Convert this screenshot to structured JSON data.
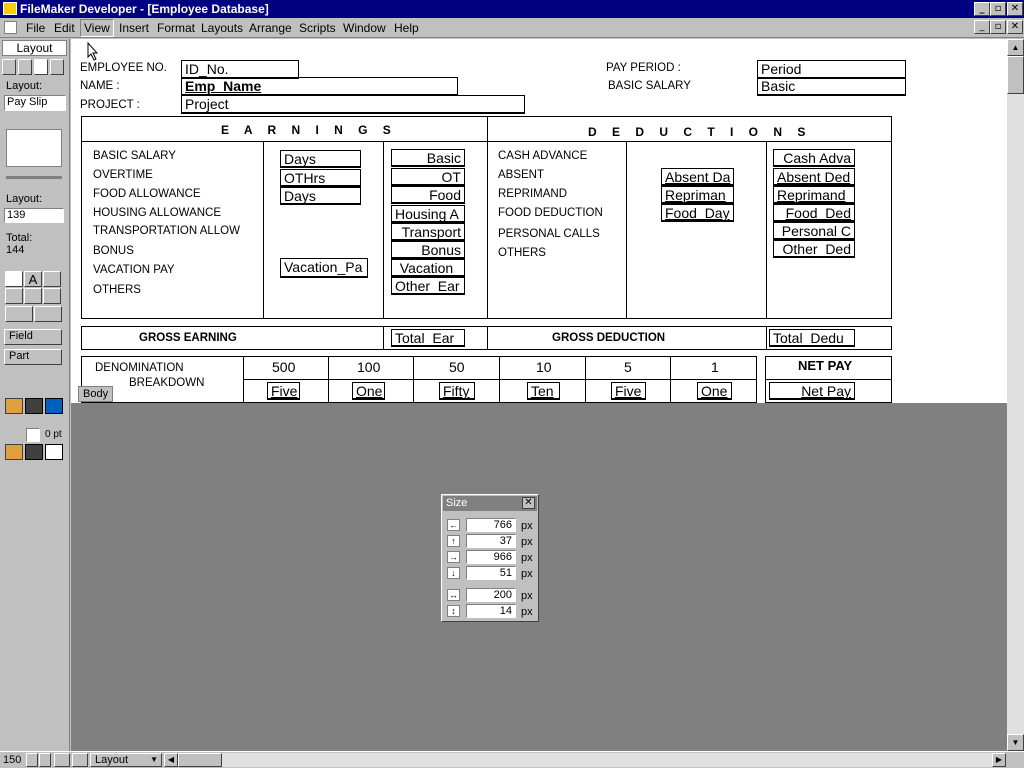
{
  "window": {
    "title": "FileMaker Developer - [Employee Database]"
  },
  "menu": [
    "File",
    "Edit",
    "View",
    "Insert",
    "Format",
    "Layouts",
    "Arrange",
    "Scripts",
    "Window",
    "Help"
  ],
  "tools": {
    "mode_label": "Layout",
    "layout_label": "Layout:",
    "layout_value": "Pay Slip",
    "layout_num_label": "Layout:",
    "layout_num_value": "139",
    "total_label": "Total:",
    "total_value": "144",
    "field_btn": "Field",
    "part_btn": "Part",
    "line_width": "0 pt"
  },
  "form": {
    "employee_no_label": "EMPLOYEE NO.",
    "employee_no_field": "ID_No.",
    "name_label": "NAME :",
    "name_field": "Emp_Name",
    "project_label": "PROJECT :",
    "project_field": "Project",
    "pay_period_label": "PAY PERIOD :",
    "pay_period_field": "Period",
    "basic_salary_label": "BASIC SALARY",
    "basic_field": "Basic",
    "earnings_header": "E A R N I N G S",
    "deductions_header": "D E D U C T I O N S",
    "earnings_labels": [
      "BASIC SALARY",
      "OVERTIME",
      "FOOD ALLOWANCE",
      "HOUSING ALLOWANCE",
      "TRANSPORTATION ALLOW",
      "BONUS",
      "VACATION PAY",
      "OTHERS"
    ],
    "earnings_qty_fields": [
      "Days",
      "OTHrs",
      "Days",
      "Vacation_Pa"
    ],
    "earnings_amount_fields": [
      "Basic",
      "OT",
      "Food",
      "Housing A",
      "Transport",
      "Bonus",
      "Vacation_",
      "Other_Ear"
    ],
    "deduction_labels": [
      "CASH ADVANCE",
      "ABSENT",
      "REPRIMAND",
      "FOOD DEDUCTION",
      "PERSONAL CALLS",
      "OTHERS"
    ],
    "deduction_qty_fields": [
      "Absent Da",
      "Repriman",
      "Food_Day"
    ],
    "deduction_amount_fields": [
      "Cash Adva",
      "Absent Ded",
      "Reprimand",
      "Food_Ded",
      "Personal C",
      "Other_Ded"
    ],
    "gross_earning_label": "GROSS EARNING",
    "gross_earning_field": "Total_Ear",
    "gross_deduction_label": "GROSS DEDUCTION",
    "gross_deduction_field": "Total_Dedu",
    "denomination_label": "DENOMINATION",
    "breakdown_label": "BREAKDOWN",
    "denominations": [
      "500",
      "100",
      "50",
      "10",
      "5",
      "1"
    ],
    "denomination_fields": [
      "Five",
      "One",
      "Fifty",
      "Ten",
      "Five",
      "One"
    ],
    "net_pay_label": "NET PAY",
    "net_pay_field": "Net Pay",
    "body_tag": "Body"
  },
  "size_palette": {
    "title": "Size",
    "values": [
      "766",
      "37",
      "966",
      "51",
      "200",
      "14"
    ],
    "unit": "px"
  },
  "status": {
    "zoom": "150",
    "mode": "Layout"
  }
}
